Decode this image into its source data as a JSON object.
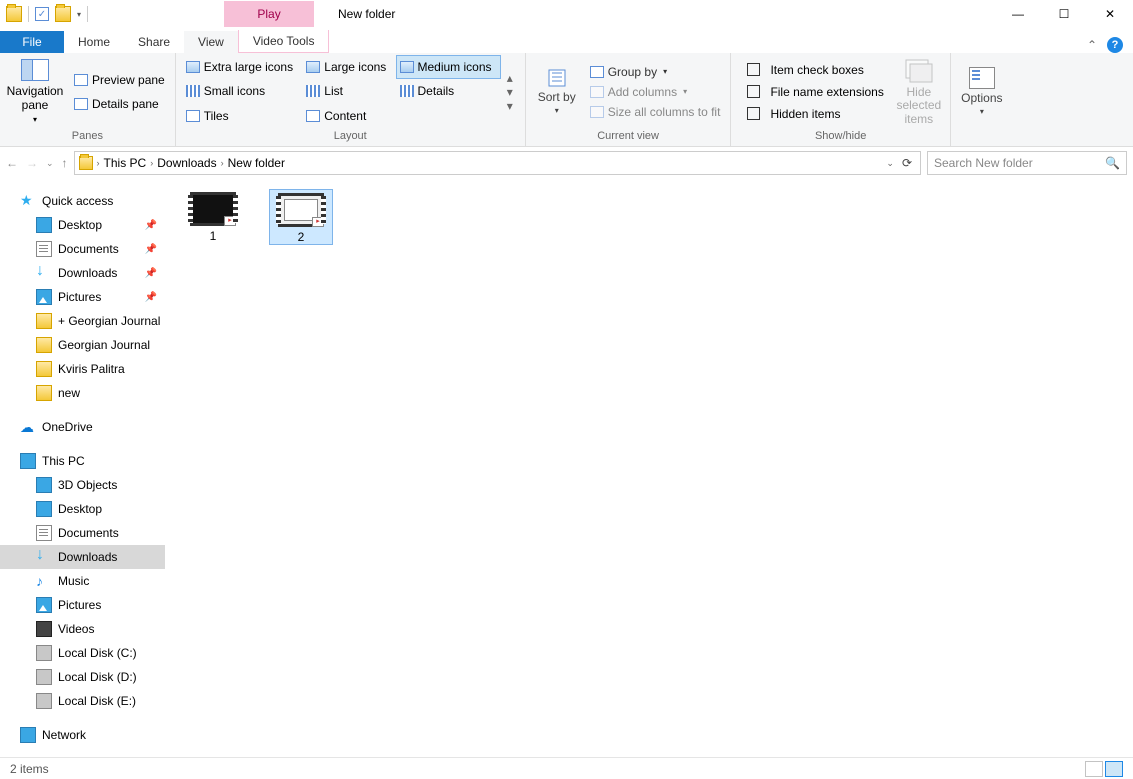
{
  "title": "New folder",
  "play_tab": "Play",
  "tabs": {
    "file": "File",
    "home": "Home",
    "share": "Share",
    "view": "View",
    "video": "Video Tools"
  },
  "ribbon": {
    "panes": {
      "label": "Panes",
      "nav": "Navigation pane",
      "preview": "Preview pane",
      "details": "Details pane"
    },
    "layout": {
      "label": "Layout",
      "xl": "Extra large icons",
      "lg": "Large icons",
      "md": "Medium icons",
      "sm": "Small icons",
      "list": "List",
      "details": "Details",
      "tiles": "Tiles",
      "content": "Content"
    },
    "current": {
      "label": "Current view",
      "sort": "Sort by",
      "group": "Group by",
      "addcols": "Add columns",
      "sizecols": "Size all columns to fit"
    },
    "show": {
      "label": "Show/hide",
      "itemchk": "Item check boxes",
      "ext": "File name extensions",
      "hidden": "Hidden items",
      "hide": "Hide selected items",
      "options": "Options"
    }
  },
  "breadcrumb": [
    "This PC",
    "Downloads",
    "New folder"
  ],
  "search_placeholder": "Search New folder",
  "tree": {
    "quick": "Quick access",
    "quick_items": [
      {
        "n": "Desktop",
        "ic": "desktop",
        "pin": true
      },
      {
        "n": "Documents",
        "ic": "doc",
        "pin": true
      },
      {
        "n": "Downloads",
        "ic": "down",
        "pin": true
      },
      {
        "n": "Pictures",
        "ic": "pic",
        "pin": true
      },
      {
        "n": "+ Georgian Journal",
        "ic": "fold"
      },
      {
        "n": "Georgian Journal",
        "ic": "fold"
      },
      {
        "n": "Kviris Palitra",
        "ic": "fold"
      },
      {
        "n": "new",
        "ic": "fold"
      }
    ],
    "onedrive": "OneDrive",
    "thispc": "This PC",
    "pc_items": [
      {
        "n": "3D Objects",
        "ic": "3d"
      },
      {
        "n": "Desktop",
        "ic": "desktop"
      },
      {
        "n": "Documents",
        "ic": "doc"
      },
      {
        "n": "Downloads",
        "ic": "down",
        "sel": true
      },
      {
        "n": "Music",
        "ic": "music"
      },
      {
        "n": "Pictures",
        "ic": "pic"
      },
      {
        "n": "Videos",
        "ic": "vid"
      },
      {
        "n": "Local Disk (C:)",
        "ic": "disk"
      },
      {
        "n": "Local Disk (D:)",
        "ic": "disk"
      },
      {
        "n": "Local Disk (E:)",
        "ic": "disk"
      }
    ],
    "network": "Network"
  },
  "files": [
    {
      "name": "1"
    },
    {
      "name": "2",
      "sel": true
    }
  ],
  "status": "2 items"
}
